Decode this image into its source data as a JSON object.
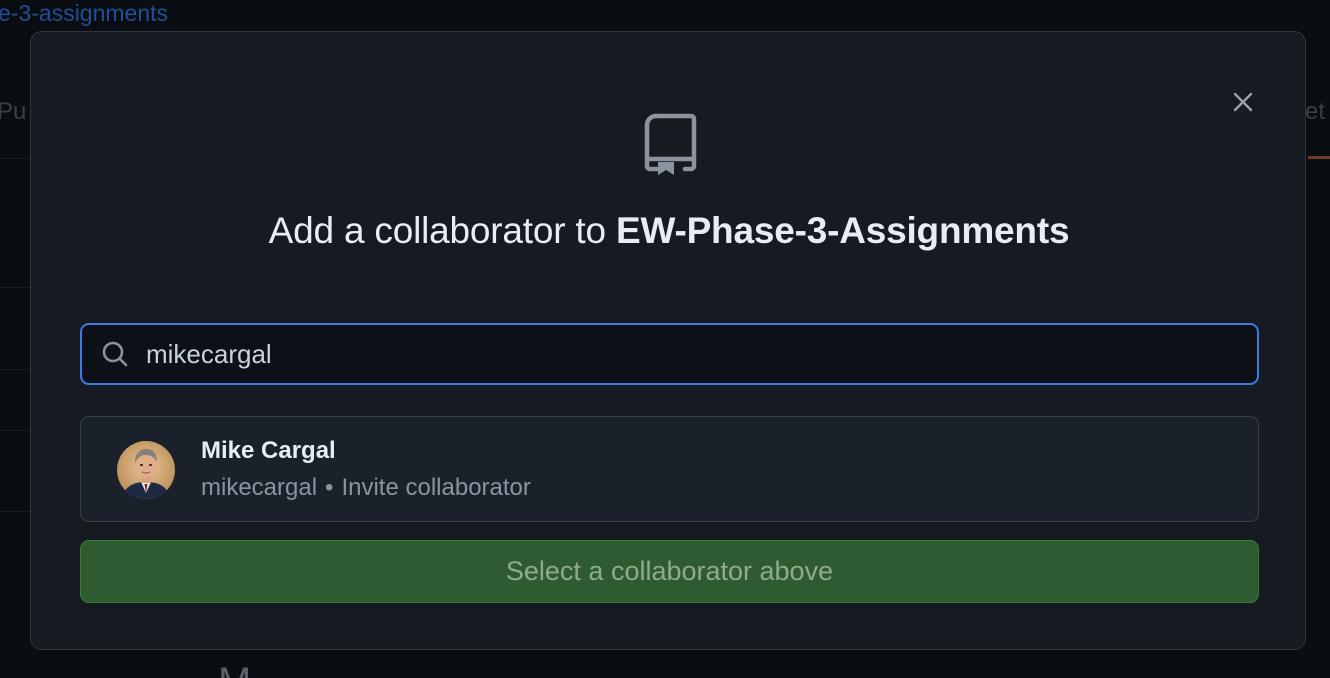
{
  "background": {
    "repo_link_fragment": "e-3-assignments",
    "tab_left_fragment": "Pu",
    "tab_right_fragment": "et",
    "bottom_glyph_fragment": "M"
  },
  "modal": {
    "close_icon": "x-icon",
    "repo_icon": "repo-icon",
    "title_prefix": "Add a collaborator to ",
    "title_repo": "EW-Phase-3-Assignments",
    "search": {
      "icon": "search-icon",
      "value": "mikecargal",
      "accent_color": "#3b7de3"
    },
    "result": {
      "name": "Mike Cargal",
      "username": "mikecargal",
      "separator": "•",
      "action": "Invite collaborator",
      "avatar_icon": "user-avatar"
    },
    "submit_button_label": "Select a collaborator above",
    "submit_button_color": "#2f5b30"
  }
}
